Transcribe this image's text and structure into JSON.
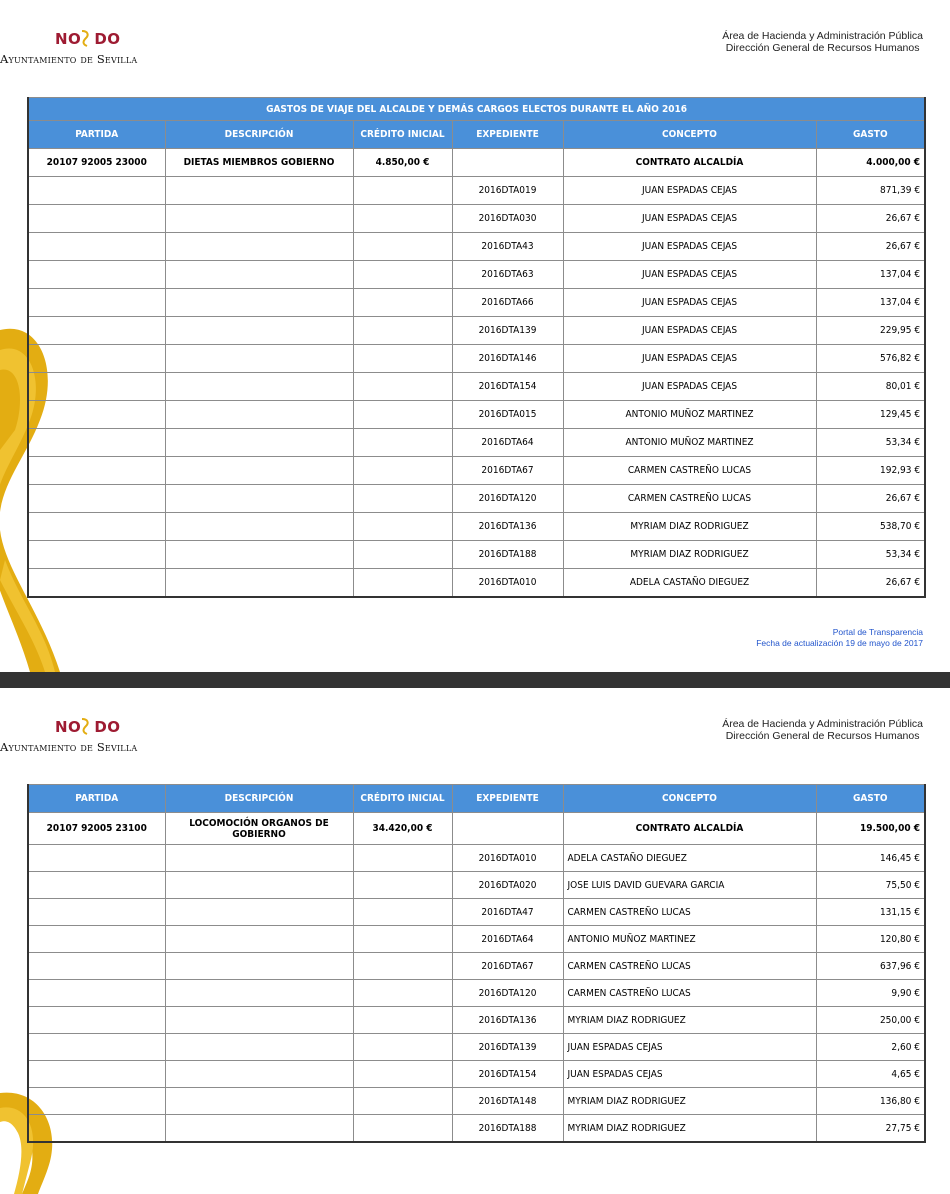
{
  "header": {
    "logo_nodo_left": "NO",
    "logo_nodo_right": "DO",
    "logo_ayuntamiento": "Ayuntamiento de Sevilla",
    "area": "Área de Hacienda y Administración Pública",
    "direccion": "Dirección General de Recursos Humanos"
  },
  "colors": {
    "header_blue": "#4a90d9",
    "brand_red": "#9e1b32",
    "brand_gold": "#e3ad12",
    "footer_blue": "#2255cc"
  },
  "columns": {
    "partida": "PARTIDA",
    "descripcion": "DESCRIPCIÓN",
    "credito": "CRÉDITO INICIAL",
    "expediente": "EXPEDIENTE",
    "concepto": "CONCEPTO",
    "gasto": "GASTO"
  },
  "page1": {
    "table_title": "GASTOS DE VIAJE DEL ALCALDE Y DEMÁS CARGOS ELECTOS DURANTE EL AÑO 2016",
    "partida": "20107 92005 23000",
    "descripcion": "DIETAS MIEMBROS GOBIERNO",
    "credito": "4.850,00 €",
    "contrato_concepto": "CONTRATO ALCALDÍA",
    "contrato_gasto": "4.000,00 €",
    "rows": [
      {
        "expediente": "2016DTA019",
        "concepto": "JUAN ESPADAS CEJAS",
        "gasto": "871,39 €"
      },
      {
        "expediente": "2016DTA030",
        "concepto": "JUAN ESPADAS CEJAS",
        "gasto": "26,67 €"
      },
      {
        "expediente": "2016DTA43",
        "concepto": "JUAN ESPADAS CEJAS",
        "gasto": "26,67 €"
      },
      {
        "expediente": "2016DTA63",
        "concepto": "JUAN ESPADAS CEJAS",
        "gasto": "137,04 €"
      },
      {
        "expediente": "2016DTA66",
        "concepto": "JUAN ESPADAS CEJAS",
        "gasto": "137,04 €"
      },
      {
        "expediente": "2016DTA139",
        "concepto": "JUAN ESPADAS CEJAS",
        "gasto": "229,95 €"
      },
      {
        "expediente": "2016DTA146",
        "concepto": "JUAN ESPADAS CEJAS",
        "gasto": "576,82 €"
      },
      {
        "expediente": "2016DTA154",
        "concepto": "JUAN ESPADAS CEJAS",
        "gasto": "80,01 €"
      },
      {
        "expediente": "2016DTA015",
        "concepto": "ANTONIO MUÑOZ MARTINEZ",
        "gasto": "129,45 €"
      },
      {
        "expediente": "2016DTA64",
        "concepto": "ANTONIO MUÑOZ MARTINEZ",
        "gasto": "53,34 €"
      },
      {
        "expediente": "2016DTA67",
        "concepto": "CARMEN CASTREÑO LUCAS",
        "gasto": "192,93 €"
      },
      {
        "expediente": "2016DTA120",
        "concepto": "CARMEN CASTREÑO LUCAS",
        "gasto": "26,67 €"
      },
      {
        "expediente": "2016DTA136",
        "concepto": "MYRIAM DIAZ RODRIGUEZ",
        "gasto": "538,70 €"
      },
      {
        "expediente": "2016DTA188",
        "concepto": "MYRIAM DIAZ RODRIGUEZ",
        "gasto": "53,34 €"
      },
      {
        "expediente": "2016DTA010",
        "concepto": "ADELA CASTAÑO DIEGUEZ",
        "gasto": "26,67 €"
      }
    ],
    "footer_line1": "Portal de Transparencia",
    "footer_line2": "Fecha de actualización 19 de mayo de 2017"
  },
  "page2": {
    "partida": "20107 92005 23100",
    "descripcion": "LOCOMOCIÓN ORGANOS DE GOBIERNO",
    "credito": "34.420,00 €",
    "contrato_concepto": "CONTRATO ALCALDÍA",
    "contrato_gasto": "19.500,00 €",
    "rows": [
      {
        "expediente": "2016DTA010",
        "concepto": "ADELA CASTAÑO DIEGUEZ",
        "gasto": "146,45 €"
      },
      {
        "expediente": "2016DTA020",
        "concepto": "JOSE LUIS DAVID GUEVARA GARCIA",
        "gasto": "75,50 €"
      },
      {
        "expediente": "2016DTA47",
        "concepto": "CARMEN CASTREÑO LUCAS",
        "gasto": "131,15 €"
      },
      {
        "expediente": "2016DTA64",
        "concepto": "ANTONIO MUÑOZ MARTINEZ",
        "gasto": "120,80 €"
      },
      {
        "expediente": "2016DTA67",
        "concepto": "CARMEN CASTREÑO LUCAS",
        "gasto": "637,96 €"
      },
      {
        "expediente": "2016DTA120",
        "concepto": "CARMEN CASTREÑO LUCAS",
        "gasto": "9,90 €"
      },
      {
        "expediente": "2016DTA136",
        "concepto": "MYRIAM DIAZ RODRIGUEZ",
        "gasto": "250,00 €"
      },
      {
        "expediente": "2016DTA139",
        "concepto": "JUAN ESPADAS CEJAS",
        "gasto": "2,60 €"
      },
      {
        "expediente": "2016DTA154",
        "concepto": "JUAN ESPADAS CEJAS",
        "gasto": "4,65 €"
      },
      {
        "expediente": "2016DTA148",
        "concepto": "MYRIAM DIAZ RODRIGUEZ",
        "gasto": "136,80 €"
      },
      {
        "expediente": "2016DTA188",
        "concepto": "MYRIAM DIAZ RODRIGUEZ",
        "gasto": "27,75 €"
      }
    ]
  }
}
